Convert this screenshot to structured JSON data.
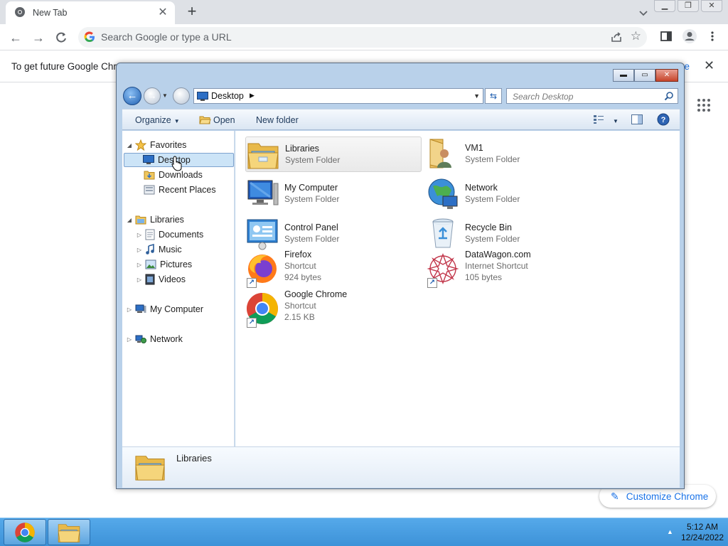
{
  "chrome": {
    "tab_title": "New Tab",
    "omnibox_placeholder": "Search Google or type a URL",
    "infobar_text": "To get future Google Chro",
    "infobar_link": "re",
    "customize_label": "Customize Chrome"
  },
  "explorer": {
    "address": "Desktop",
    "search_placeholder": "Search Desktop",
    "commands": {
      "organize": "Organize",
      "open": "Open",
      "new_folder": "New folder"
    },
    "nav": {
      "favorites": "Favorites",
      "desktop": "Desktop",
      "downloads": "Downloads",
      "recent_places": "Recent Places",
      "libraries": "Libraries",
      "documents": "Documents",
      "music": "Music",
      "pictures": "Pictures",
      "videos": "Videos",
      "my_computer": "My Computer",
      "network": "Network"
    },
    "items": [
      {
        "name": "Libraries",
        "line1": "System Folder",
        "line2": "",
        "icon": "libraries-icon"
      },
      {
        "name": "VM1",
        "line1": "System Folder",
        "line2": "",
        "icon": "user-folder-icon"
      },
      {
        "name": "My Computer",
        "line1": "System Folder",
        "line2": "",
        "icon": "computer-icon"
      },
      {
        "name": "Network",
        "line1": "System Folder",
        "line2": "",
        "icon": "network-icon"
      },
      {
        "name": "Control Panel",
        "line1": "System Folder",
        "line2": "",
        "icon": "control-panel-icon"
      },
      {
        "name": "Recycle Bin",
        "line1": "System Folder",
        "line2": "",
        "icon": "recycle-bin-icon"
      },
      {
        "name": "Firefox",
        "line1": "Shortcut",
        "line2": "924 bytes",
        "icon": "firefox-icon"
      },
      {
        "name": "DataWagon.com",
        "line1": "Internet Shortcut",
        "line2": "105 bytes",
        "icon": "datawagon-icon"
      },
      {
        "name": "Google Chrome",
        "line1": "Shortcut",
        "line2": "2.15 KB",
        "icon": "chrome-icon"
      }
    ],
    "details_name": "Libraries"
  },
  "taskbar": {
    "time": "5:12 AM",
    "date": "12/24/2022"
  },
  "colors": {
    "chrome_link": "#1a73e8",
    "taskbar": "#4a9fe2",
    "selection": "#cce4f7"
  }
}
